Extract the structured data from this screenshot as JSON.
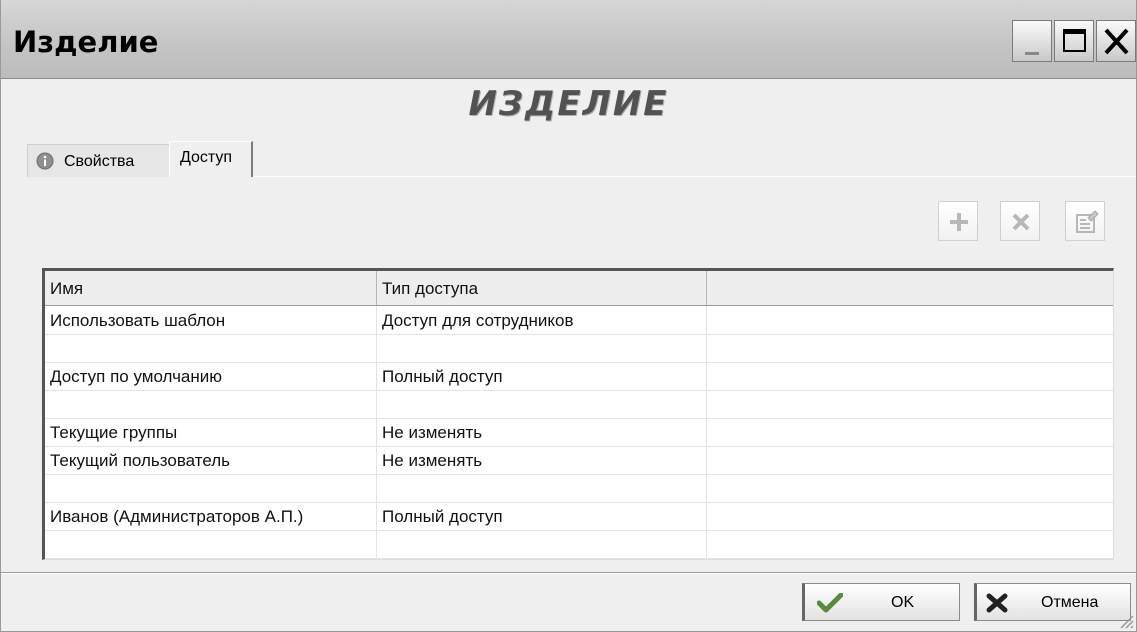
{
  "window": {
    "title": "Изделие"
  },
  "heading": "ИЗДЕЛИЕ",
  "tabs": [
    {
      "label": "Свойства",
      "icon": "info-icon",
      "active": false
    },
    {
      "label": "Доступ",
      "active": true
    }
  ],
  "toolbar": {
    "add_icon": "plus-icon",
    "delete_icon": "x-icon",
    "properties_icon": "properties-icon",
    "disabled": true
  },
  "table": {
    "columns": [
      "Имя",
      "Тип доступа",
      ""
    ],
    "rows": [
      [
        "Использовать шаблон",
        "Доступ для сотрудников",
        ""
      ],
      [
        "",
        "",
        ""
      ],
      [
        "Доступ по умолчанию",
        "Полный доступ",
        ""
      ],
      [
        "",
        "",
        ""
      ],
      [
        "Текущие группы",
        "Не изменять",
        ""
      ],
      [
        "Текущий пользователь",
        "Не изменять",
        ""
      ],
      [
        "",
        "",
        ""
      ],
      [
        "Иванов (Администраторов А.П.)",
        "Полный доступ",
        ""
      ],
      [
        "",
        "",
        ""
      ]
    ]
  },
  "buttons": {
    "ok": "OK",
    "cancel": "Отмена"
  },
  "colors": {
    "window_bg": "#efefef",
    "titlebar": "#c4c4c4",
    "heading": "#525252",
    "check_green": "#5a8a3c",
    "grid_border": "#555555"
  }
}
